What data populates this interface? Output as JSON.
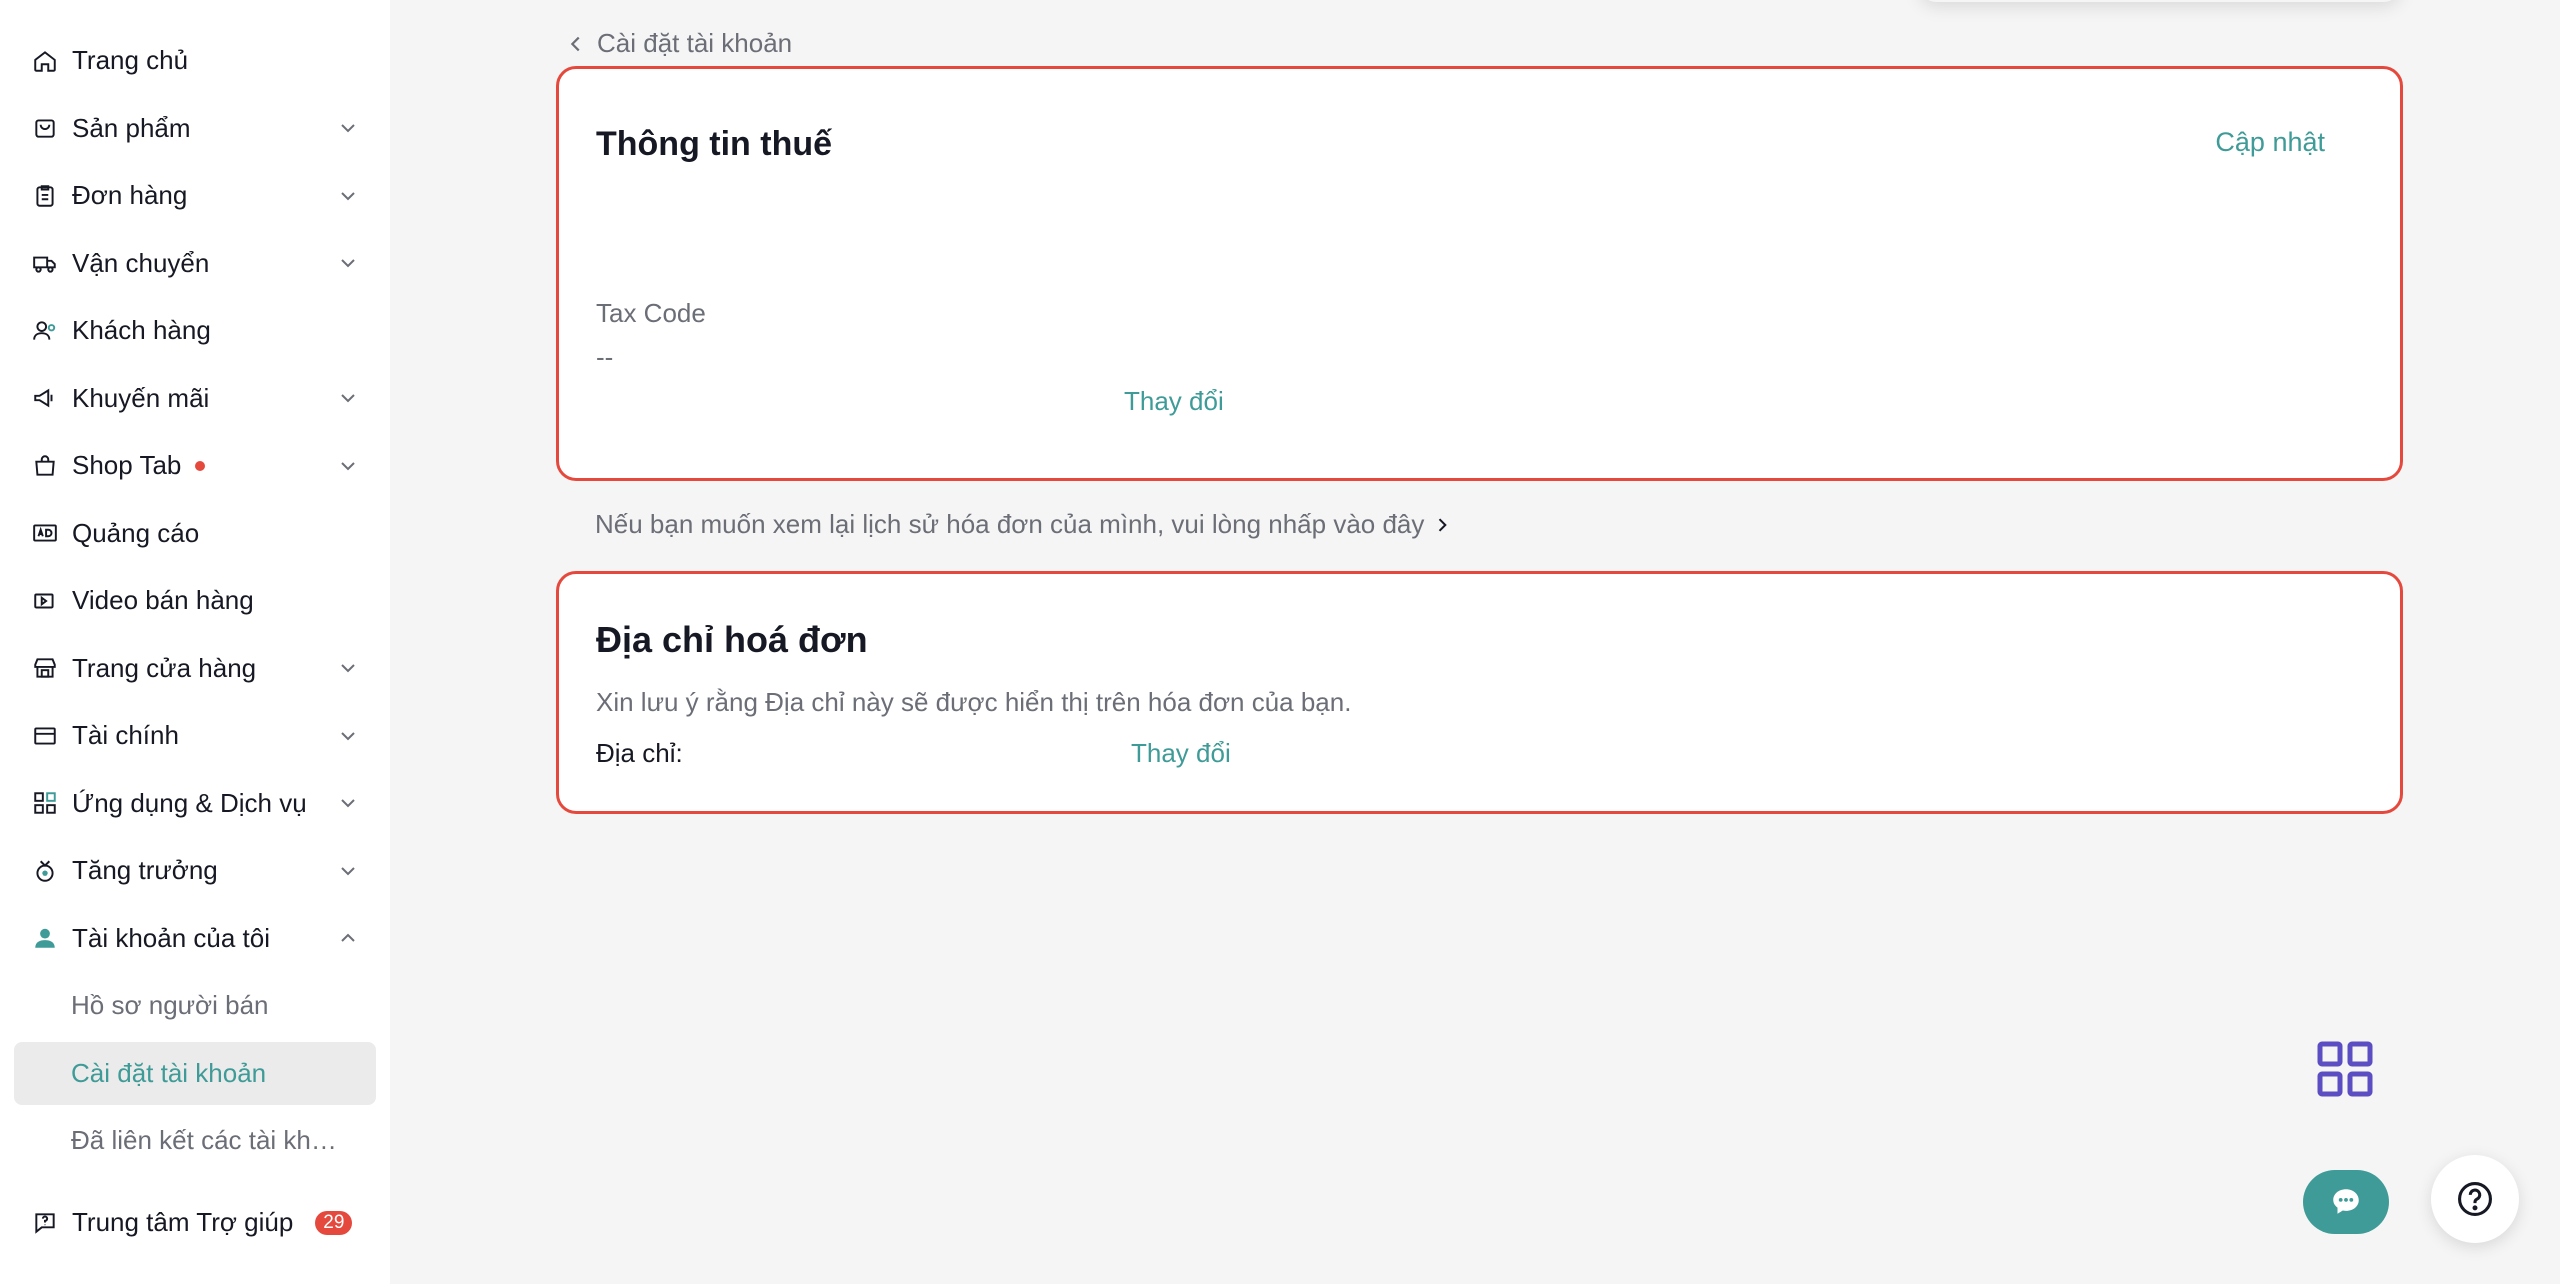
{
  "sidebar": {
    "items": [
      {
        "label": "Trang chủ",
        "icon": "home-icon",
        "expandable": false
      },
      {
        "label": "Sản phẩm",
        "icon": "product-bag-icon",
        "expandable": true
      },
      {
        "label": "Đơn hàng",
        "icon": "clipboard-icon",
        "expandable": true
      },
      {
        "label": "Vận chuyển",
        "icon": "truck-icon",
        "expandable": true
      },
      {
        "label": "Khách hàng",
        "icon": "users-icon",
        "expandable": false
      },
      {
        "label": "Khuyến mãi",
        "icon": "megaphone-icon",
        "expandable": true
      },
      {
        "label": "Shop Tab",
        "icon": "shopping-bag-icon",
        "expandable": true,
        "dot": true
      },
      {
        "label": "Quảng cáo",
        "icon": "ad-icon",
        "expandable": false
      },
      {
        "label": "Video bán hàng",
        "icon": "video-icon",
        "expandable": false
      },
      {
        "label": "Trang cửa hàng",
        "icon": "storefront-icon",
        "expandable": true
      },
      {
        "label": "Tài chính",
        "icon": "wallet-icon",
        "expandable": true
      },
      {
        "label": "Ứng dụng & Dịch vụ",
        "icon": "apps-grid-icon",
        "expandable": true
      },
      {
        "label": "Tăng trưởng",
        "icon": "growth-medal-icon",
        "expandable": true
      },
      {
        "label": "Tài khoản của tôi",
        "icon": "user-account-icon",
        "expandable": true,
        "expanded": true
      }
    ],
    "sub_items": [
      {
        "label": "Hồ sơ người bán"
      },
      {
        "label": "Cài đặt tài khoản",
        "active": true
      },
      {
        "label": "Đã liên kết các tài khoả..."
      }
    ],
    "help": {
      "label": "Trung tâm Trợ giúp",
      "badge": "29",
      "icon": "help-chat-icon"
    }
  },
  "breadcrumb": {
    "label": "Cài đặt tài khoản"
  },
  "tax_card": {
    "title": "Thông tin thuế",
    "update_label": "Cập nhật",
    "field_label": "Tax Code",
    "field_value": "--",
    "change_label": "Thay đổi"
  },
  "history_link": {
    "label": "Nếu bạn muốn xem lại lịch sử hóa đơn của mình, vui lòng nhấp vào đây"
  },
  "address_card": {
    "title": "Địa chỉ hoá đơn",
    "note": "Xin lưu ý rằng Địa chỉ này sẽ được hiển thị trên hóa đơn của bạn.",
    "address_label": "Địa chỉ:",
    "change_label": "Thay đổi"
  },
  "colors": {
    "accent": "#3f9b97",
    "danger": "#e5493d",
    "apps": "#5b4ec3"
  }
}
